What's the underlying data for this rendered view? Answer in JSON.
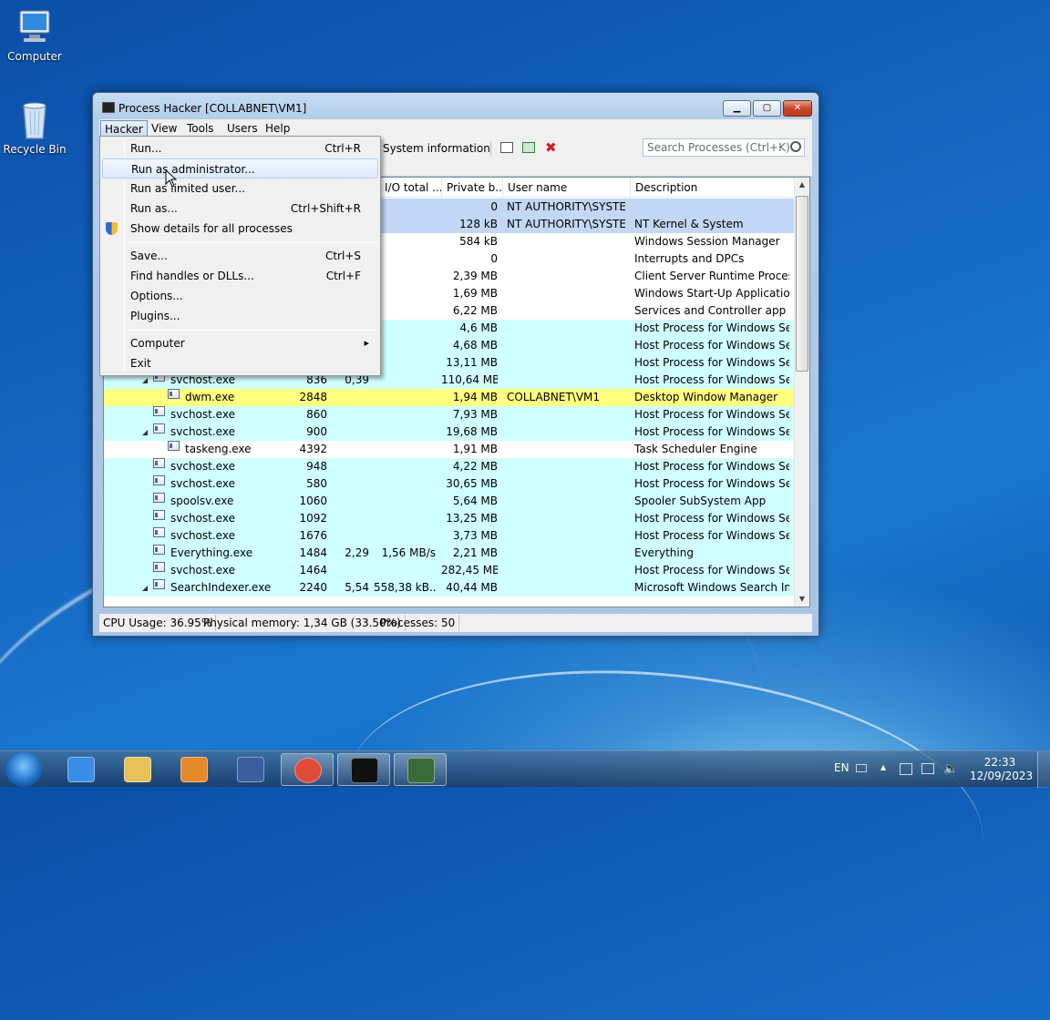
{
  "desktop": {
    "icons": [
      {
        "label": "Computer",
        "icon": "computer-icon"
      },
      {
        "label": "Recycle Bin",
        "icon": "recycle-bin-icon"
      }
    ]
  },
  "window": {
    "title": "Process Hacker [COLLABNET\\VM1]",
    "buttons": {
      "minimize": "▁",
      "maximize": "▢",
      "close": "✕"
    },
    "menubar": [
      "Hacker",
      "View",
      "Tools",
      "Users",
      "Help"
    ],
    "toolbar": {
      "sysinfo_label": "System information",
      "search_placeholder": "Search Processes (Ctrl+K)"
    },
    "columns": [
      "",
      "I/O total ...",
      "Private b...",
      "User name",
      "Description"
    ],
    "rows": [
      {
        "name": "",
        "pid": "",
        "cpu": "",
        "io": "",
        "priv": "0",
        "user": "NT AUTHORITY\\SYSTEM",
        "desc": "",
        "bg": "#c2d8f6",
        "indent": 0,
        "tree": ""
      },
      {
        "name": "",
        "pid": "",
        "cpu": "",
        "io": "",
        "priv": "128 kB",
        "user": "NT AUTHORITY\\SYSTEM",
        "desc": "NT Kernel & System",
        "bg": "#c2d8f6",
        "indent": 0,
        "tree": ""
      },
      {
        "name": "",
        "pid": "",
        "cpu": "",
        "io": "",
        "priv": "584 kB",
        "user": "",
        "desc": "Windows Session Manager",
        "bg": "#ffffff",
        "indent": 0,
        "tree": ""
      },
      {
        "name": "",
        "pid": "",
        "cpu": "",
        "io": "",
        "priv": "0",
        "user": "",
        "desc": "Interrupts and DPCs",
        "bg": "#ffffff",
        "indent": 0,
        "tree": ""
      },
      {
        "name": "",
        "pid": "",
        "cpu": "",
        "io": "",
        "priv": "2,39 MB",
        "user": "",
        "desc": "Client Server Runtime Process",
        "bg": "#ffffff",
        "indent": 0,
        "tree": ""
      },
      {
        "name": "",
        "pid": "",
        "cpu": "",
        "io": "",
        "priv": "1,69 MB",
        "user": "",
        "desc": "Windows Start-Up Application",
        "bg": "#ffffff",
        "indent": 0,
        "tree": ""
      },
      {
        "name": "",
        "pid": "",
        "cpu": "",
        "io": "",
        "priv": "6,22 MB",
        "user": "",
        "desc": "Services and Controller app",
        "bg": "#ffffff",
        "indent": 0,
        "tree": ""
      },
      {
        "name": "",
        "pid": "",
        "cpu": "",
        "io": "",
        "priv": "4,6 MB",
        "user": "",
        "desc": "Host Process for Windows Ser...",
        "bg": "#d0ffff",
        "indent": 0,
        "tree": ""
      },
      {
        "name": "",
        "pid": "",
        "cpu": "",
        "io": "",
        "priv": "4,68 MB",
        "user": "",
        "desc": "Host Process for Windows Ser...",
        "bg": "#d0ffff",
        "indent": 0,
        "tree": ""
      },
      {
        "name": "",
        "pid": "",
        "cpu": "",
        "io": "",
        "priv": "13,11 MB",
        "user": "",
        "desc": "Host Process for Windows Ser...",
        "bg": "#d0ffff",
        "indent": 0,
        "tree": ""
      },
      {
        "name": "svchost.exe",
        "pid": "836",
        "cpu": "0,39",
        "io": "",
        "priv": "110,64 MB",
        "user": "",
        "desc": "Host Process for Windows Ser...",
        "bg": "#d0ffff",
        "indent": 1,
        "tree": "◢"
      },
      {
        "name": "dwm.exe",
        "pid": "2848",
        "cpu": "",
        "io": "",
        "priv": "1,94 MB",
        "user": "COLLABNET\\VM1",
        "desc": "Desktop Window Manager",
        "bg": "#ffff80",
        "indent": 2,
        "tree": ""
      },
      {
        "name": "svchost.exe",
        "pid": "860",
        "cpu": "",
        "io": "",
        "priv": "7,93 MB",
        "user": "",
        "desc": "Host Process for Windows Ser...",
        "bg": "#d0ffff",
        "indent": 1,
        "tree": ""
      },
      {
        "name": "svchost.exe",
        "pid": "900",
        "cpu": "",
        "io": "",
        "priv": "19,68 MB",
        "user": "",
        "desc": "Host Process for Windows Ser...",
        "bg": "#d0ffff",
        "indent": 1,
        "tree": "◢"
      },
      {
        "name": "taskeng.exe",
        "pid": "4392",
        "cpu": "",
        "io": "",
        "priv": "1,91 MB",
        "user": "",
        "desc": "Task Scheduler Engine",
        "bg": "#ffffff",
        "indent": 2,
        "tree": ""
      },
      {
        "name": "svchost.exe",
        "pid": "948",
        "cpu": "",
        "io": "",
        "priv": "4,22 MB",
        "user": "",
        "desc": "Host Process for Windows Ser...",
        "bg": "#d0ffff",
        "indent": 1,
        "tree": ""
      },
      {
        "name": "svchost.exe",
        "pid": "580",
        "cpu": "",
        "io": "",
        "priv": "30,65 MB",
        "user": "",
        "desc": "Host Process for Windows Ser...",
        "bg": "#d0ffff",
        "indent": 1,
        "tree": ""
      },
      {
        "name": "spoolsv.exe",
        "pid": "1060",
        "cpu": "",
        "io": "",
        "priv": "5,64 MB",
        "user": "",
        "desc": "Spooler SubSystem App",
        "bg": "#d0ffff",
        "indent": 1,
        "tree": ""
      },
      {
        "name": "svchost.exe",
        "pid": "1092",
        "cpu": "",
        "io": "",
        "priv": "13,25 MB",
        "user": "",
        "desc": "Host Process for Windows Ser...",
        "bg": "#d0ffff",
        "indent": 1,
        "tree": ""
      },
      {
        "name": "svchost.exe",
        "pid": "1676",
        "cpu": "",
        "io": "",
        "priv": "3,73 MB",
        "user": "",
        "desc": "Host Process for Windows Ser...",
        "bg": "#d0ffff",
        "indent": 1,
        "tree": ""
      },
      {
        "name": "Everything.exe",
        "pid": "1484",
        "cpu": "2,29",
        "io": "1,56 MB/s",
        "priv": "2,21 MB",
        "user": "",
        "desc": "Everything",
        "bg": "#d0ffff",
        "indent": 1,
        "tree": ""
      },
      {
        "name": "svchost.exe",
        "pid": "1464",
        "cpu": "",
        "io": "",
        "priv": "282,45 MB",
        "user": "",
        "desc": "Host Process for Windows Ser...",
        "bg": "#d0ffff",
        "indent": 1,
        "tree": ""
      },
      {
        "name": "SearchIndexer.exe",
        "pid": "2240",
        "cpu": "5,54",
        "io": "558,38 kB...",
        "priv": "40,44 MB",
        "user": "",
        "desc": "Microsoft Windows Search In...",
        "bg": "#d0ffff",
        "indent": 1,
        "tree": "◢"
      }
    ],
    "status": {
      "cpu": "CPU Usage: 36.95%",
      "memory": "Physical memory: 1,34 GB (33.50%)",
      "processes": "Processes: 50"
    }
  },
  "hacker_menu": [
    {
      "label": "Run...",
      "shortcut": "Ctrl+R"
    },
    {
      "label": "Run as administrator...",
      "shortcut": "",
      "highlight": true
    },
    {
      "label": "Run as limited user...",
      "shortcut": ""
    },
    {
      "label": "Run as...",
      "shortcut": "Ctrl+Shift+R"
    },
    {
      "label": "Show details for all processes",
      "shortcut": "",
      "icon": "shield-icon"
    },
    {
      "sep": true
    },
    {
      "label": "Save...",
      "shortcut": "Ctrl+S"
    },
    {
      "label": "Find handles or DLLs...",
      "shortcut": "Ctrl+F"
    },
    {
      "label": "Options...",
      "shortcut": ""
    },
    {
      "label": "Plugins...",
      "shortcut": ""
    },
    {
      "sep": true
    },
    {
      "label": "Computer",
      "shortcut": "",
      "submenu": true
    },
    {
      "label": "Exit",
      "shortcut": ""
    }
  ],
  "taskbar": {
    "start": "start-orb-icon",
    "apps": [
      {
        "name": "internet-explorer-icon",
        "open": false
      },
      {
        "name": "file-explorer-icon",
        "open": false
      },
      {
        "name": "media-player-icon",
        "open": false
      },
      {
        "name": "virtualbox-icon",
        "open": false
      },
      {
        "name": "chrome-icon",
        "open": true
      },
      {
        "name": "command-prompt-icon",
        "open": true
      },
      {
        "name": "process-hacker-icon",
        "open": true
      }
    ],
    "tray": {
      "lang": "EN",
      "time": "22:33",
      "date": "12/09/2023"
    }
  }
}
